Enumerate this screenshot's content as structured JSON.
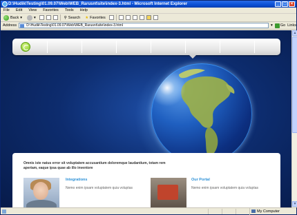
{
  "window": {
    "title": "D:\\Hudik\\Testing\\01.09.07\\Web\\WEB_Rarusnt\\site\\index-3.html - Microsoft Internet Explorer",
    "minimize": "_",
    "maximize": "□",
    "close": "×"
  },
  "menu": [
    "File",
    "Edit",
    "View",
    "Favorites",
    "Tools",
    "Help"
  ],
  "toolbar": {
    "back": "Back",
    "search": "Search",
    "favorites": "Favorites"
  },
  "address": {
    "label": "Address",
    "value": "D:\\Hudik\\Testing\\01.09.07\\Web\\WEB_Rarusnt\\site\\index-3.html",
    "go": "Go",
    "links": "Links"
  },
  "page": {
    "intro": "Omnis iste natus error sit voluptatem accusantium doloremque laudantium, totam rem aperiam, eaque ipsa quae ab illo inventore",
    "items": [
      {
        "title": "Integrations",
        "text": "Nemo enim ipsam voluptatem quia voluptas"
      },
      {
        "title": "Our Portal",
        "text": "Nemo enim ipsam voluptatem quia voluptas"
      }
    ]
  },
  "status": {
    "zone": "My Computer"
  }
}
